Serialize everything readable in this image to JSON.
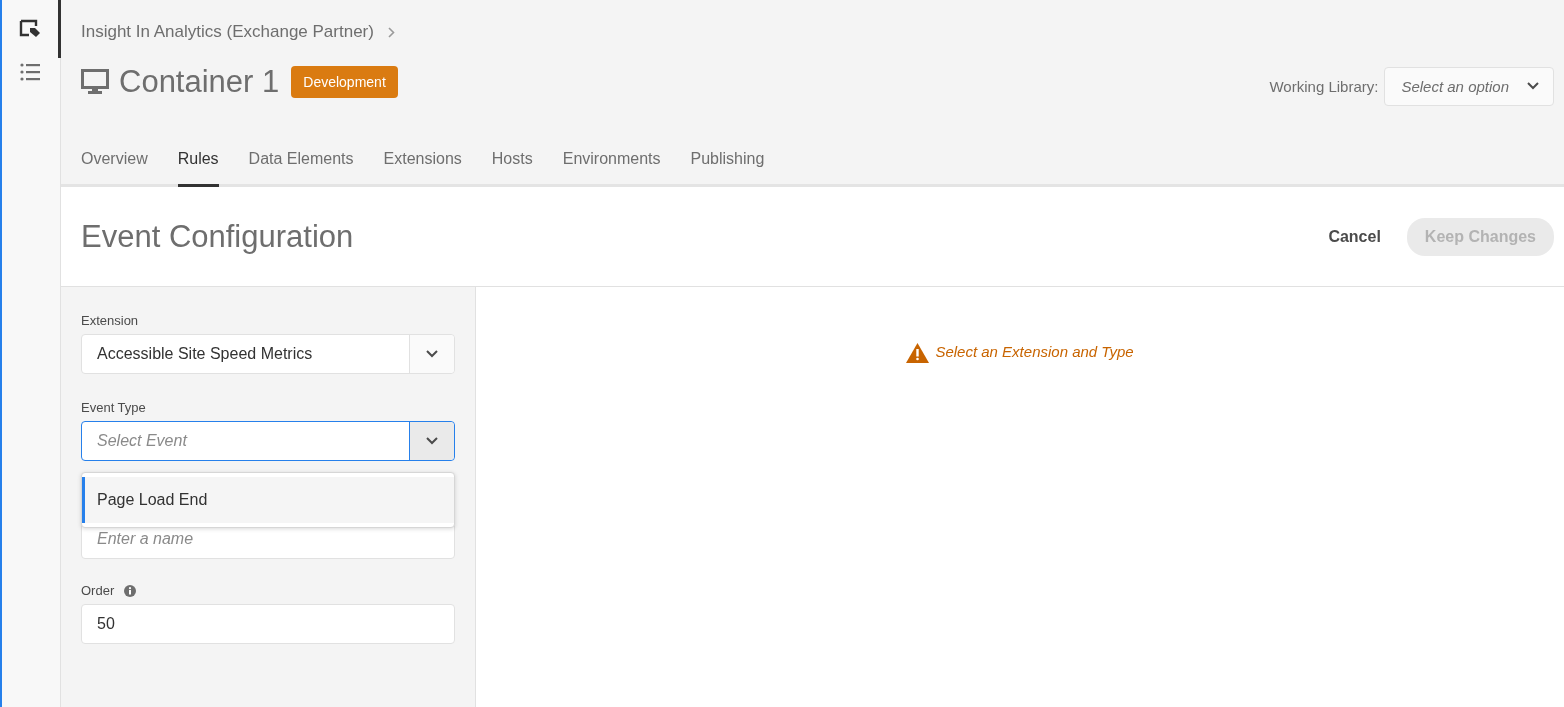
{
  "rail": {
    "items": [
      {
        "kind": "tag",
        "selected": true
      },
      {
        "kind": "list",
        "selected": false
      }
    ]
  },
  "header": {
    "breadcrumb": "Insight In Analytics (Exchange Partner)",
    "title": "Container 1",
    "badge": "Development",
    "working_library": {
      "label": "Working Library:",
      "placeholder": "Select an option"
    }
  },
  "tabs": [
    {
      "label": "Overview",
      "selected": false
    },
    {
      "label": "Rules",
      "selected": true
    },
    {
      "label": "Data Elements",
      "selected": false
    },
    {
      "label": "Extensions",
      "selected": false
    },
    {
      "label": "Hosts",
      "selected": false
    },
    {
      "label": "Environments",
      "selected": false
    },
    {
      "label": "Publishing",
      "selected": false
    }
  ],
  "editor": {
    "title": "Event Configuration",
    "cancel": "Cancel",
    "keep_changes": {
      "label": "Keep Changes",
      "disabled": true
    }
  },
  "form": {
    "extension": {
      "label": "Extension",
      "value": "Accessible Site Speed Metrics",
      "focused": false
    },
    "event_type": {
      "label": "Event Type",
      "placeholder": "Select Event",
      "focused": true,
      "options": [
        {
          "label": "Page Load End",
          "selected": true
        }
      ]
    },
    "name": {
      "placeholder": "Enter a name"
    },
    "order": {
      "label": "Order",
      "value": "50"
    }
  },
  "message": "Select an Extension and Type"
}
